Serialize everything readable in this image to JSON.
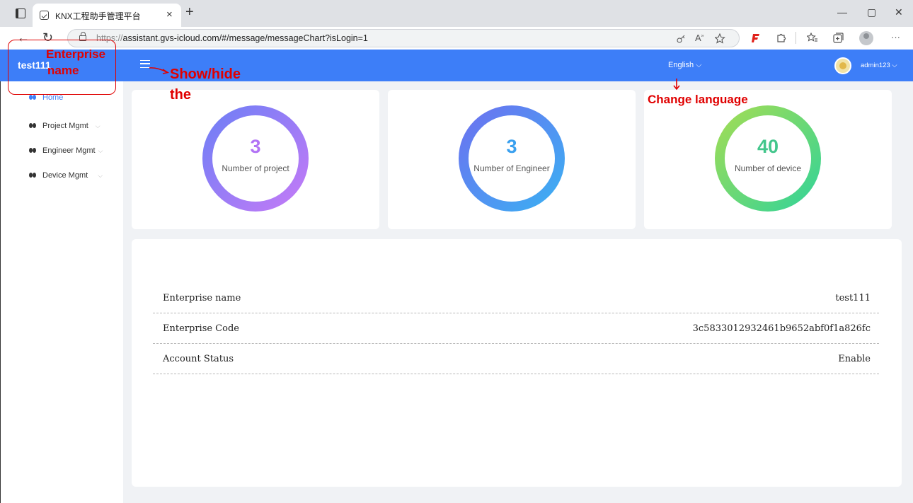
{
  "browser": {
    "tab_title": "KNX工程助手管理平台",
    "tab_close": "×",
    "new_tab": "+",
    "url_scheme": "https://",
    "url_rest": "assistant.gvs-icloud.com/#/message/messageChart?isLogin=1",
    "window_controls": [
      "—",
      "▢",
      "✕"
    ],
    "nav": {
      "back": "←",
      "reload": "↻"
    },
    "toolbar_icons": [
      "key-icon",
      "read-aloud-icon",
      "favorites-add-icon",
      "extension-f-icon",
      "extensions-icon",
      "favorites-icon",
      "collections-icon",
      "profile-icon",
      "more-icon"
    ],
    "more": "···"
  },
  "header": {
    "brand": "test111",
    "language": "English ⌵",
    "user": "admin123 ⌵",
    "color": "#3d7ef8"
  },
  "sidebar": {
    "items": [
      {
        "label": "Home",
        "active": true
      },
      {
        "label": "Project Mgmt",
        "chevron": "⌵"
      },
      {
        "label": "Engineer Mgmt",
        "chevron": "⌵"
      },
      {
        "label": "Device Mgmt",
        "chevron": "⌵"
      }
    ]
  },
  "stats": [
    {
      "value": "3",
      "label": "Number of project",
      "color": "#b273f5",
      "gradient": [
        "#6b7ff5",
        "#c77af7"
      ]
    },
    {
      "value": "3",
      "label": "Number of Engineer",
      "color": "#3aa0ef",
      "gradient": [
        "#6e6ff0",
        "#39b2f3"
      ]
    },
    {
      "value": "40",
      "label": "Number of device",
      "color": "#43c68c",
      "gradient": [
        "#a7dd52",
        "#2fd39a"
      ]
    }
  ],
  "info": {
    "rows": [
      {
        "label": "Enterprise name",
        "value": "test111"
      },
      {
        "label": "Enterprise Code",
        "value": "3c5833012932461b9652abf0f1a826fc"
      },
      {
        "label": "Account Status",
        "value": "Enable"
      }
    ]
  },
  "annotations": {
    "enterprise_line1": "Enterprise",
    "enterprise_line2": "name",
    "showhide_line1": "Show/hide",
    "showhide_line2": "the",
    "change_language": "Change language",
    "color": "#e00000"
  }
}
